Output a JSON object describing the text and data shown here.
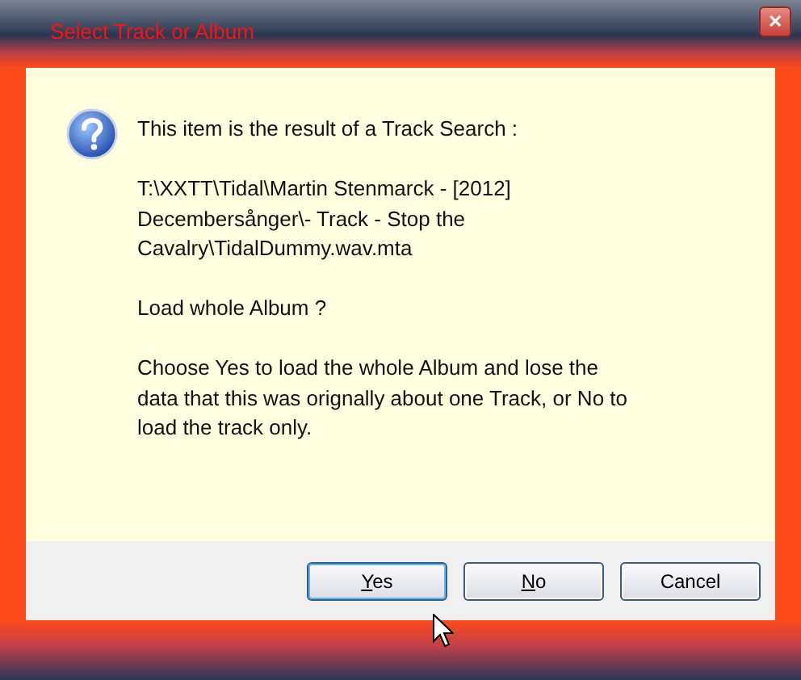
{
  "window": {
    "title": "Select Track or Album",
    "close": "✕"
  },
  "message": {
    "paragraphs": [
      "This item is the result of a Track Search :",
      "T:\\XXTT\\Tidal\\Martin Stenmarck - [2012]\nDecembersånger\\- Track - Stop the\nCavalry\\TidalDummy.wav.mta",
      "Load whole Album ?",
      "Choose Yes to load the whole Album and lose the\ndata that this was orignally about one Track, or No to\nload the track only."
    ]
  },
  "buttons": [
    {
      "label": "Yes",
      "accelerator": true,
      "default": true
    },
    {
      "label": "No",
      "accelerator": true,
      "default": false
    },
    {
      "label": "Cancel",
      "accelerator": false,
      "default": false
    }
  ]
}
